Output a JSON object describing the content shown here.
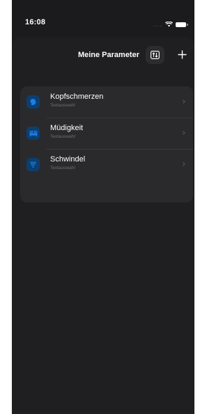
{
  "status_bar": {
    "time": "16:08",
    "signal": "....",
    "wifi_icon": "wifi-icon",
    "battery_icon": "battery-icon"
  },
  "nav": {
    "title": "Meine Parameter",
    "sort_icon": "sort-arrows-icon",
    "add_icon": "plus-icon"
  },
  "parameters": [
    {
      "title": "Kopfschmerzen",
      "subtitle": "Textauswahl",
      "icon": "head-icon"
    },
    {
      "title": "Müdigkeit",
      "subtitle": "Textauswahl",
      "icon": "bed-icon"
    },
    {
      "title": "Schwindel",
      "subtitle": "Textauswahl",
      "icon": "dizziness-icon"
    }
  ],
  "colors": {
    "background": "#1b1b1d",
    "card": "#2a2a2c",
    "accent": "#1a7fe6",
    "icon_bg": "#0d3e70"
  }
}
